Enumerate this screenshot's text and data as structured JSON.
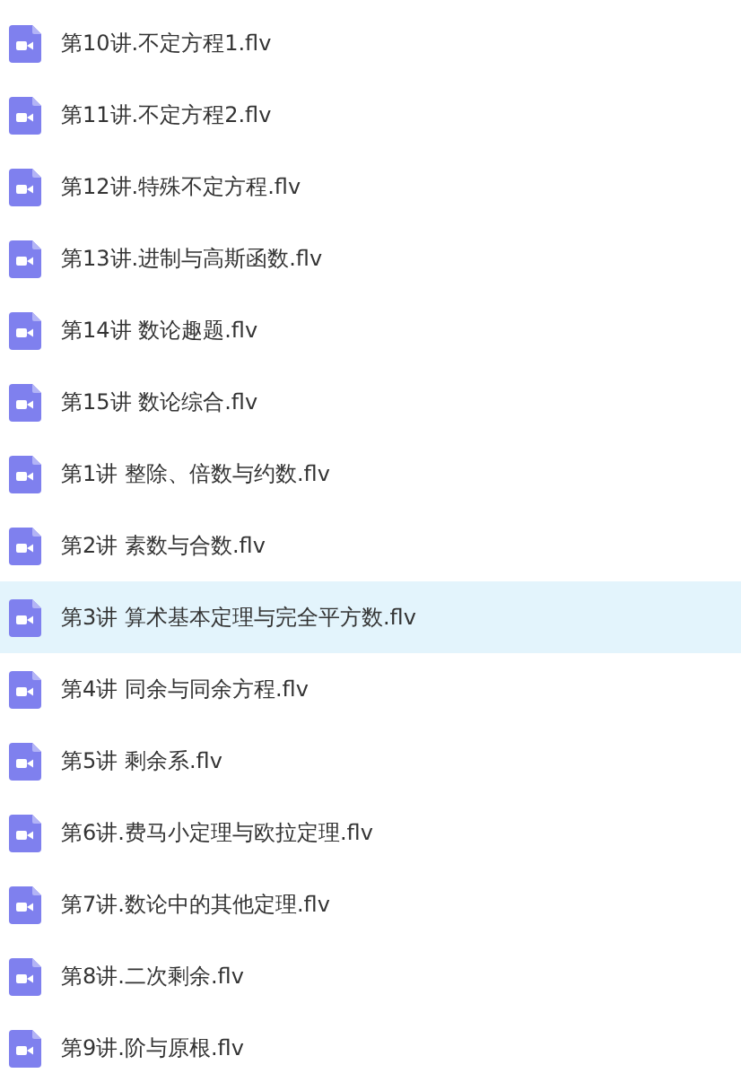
{
  "files": [
    {
      "name": "第10讲.不定方程1.flv",
      "selected": false
    },
    {
      "name": "第11讲.不定方程2.flv",
      "selected": false
    },
    {
      "name": "第12讲.特殊不定方程.flv",
      "selected": false
    },
    {
      "name": "第13讲.进制与高斯函数.flv",
      "selected": false
    },
    {
      "name": "第14讲 数论趣题.flv",
      "selected": false
    },
    {
      "name": "第15讲 数论综合.flv",
      "selected": false
    },
    {
      "name": "第1讲 整除、倍数与约数.flv",
      "selected": false
    },
    {
      "name": "第2讲 素数与合数.flv",
      "selected": false
    },
    {
      "name": "第3讲 算术基本定理与完全平方数.flv",
      "selected": true
    },
    {
      "name": "第4讲 同余与同余方程.flv",
      "selected": false
    },
    {
      "name": "第5讲 剩余系.flv",
      "selected": false
    },
    {
      "name": "第6讲.费马小定理与欧拉定理.flv",
      "selected": false
    },
    {
      "name": "第7讲.数论中的其他定理.flv",
      "selected": false
    },
    {
      "name": "第8讲.二次剩余.flv",
      "selected": false
    },
    {
      "name": "第9讲.阶与原根.flv",
      "selected": false
    }
  ]
}
